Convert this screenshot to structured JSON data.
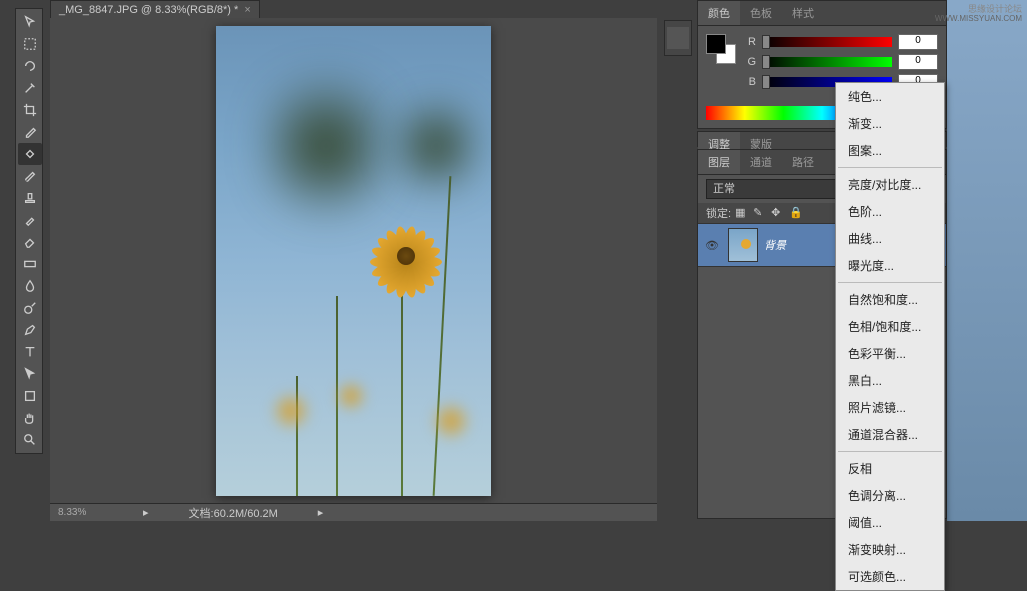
{
  "document": {
    "tab_title": "_MG_8847.JPG @ 8.33%(RGB/8*) *"
  },
  "status": {
    "zoom": "8.33%",
    "doc_label": "文档:60.2M/60.2M"
  },
  "color_panel": {
    "tabs": [
      "颜色",
      "色板",
      "样式"
    ],
    "channels": {
      "r": {
        "label": "R",
        "value": "0"
      },
      "g": {
        "label": "G",
        "value": "0"
      },
      "b": {
        "label": "B",
        "value": "0"
      }
    }
  },
  "adjust_panel": {
    "tabs": [
      "调整",
      "蒙版"
    ]
  },
  "layers_panel": {
    "tabs": [
      "图层",
      "通道",
      "路径"
    ],
    "blend_mode": "正常",
    "lock_label": "锁定:",
    "layer_name": "背景"
  },
  "context_menu": {
    "items": [
      {
        "label": "纯色..."
      },
      {
        "label": "渐变..."
      },
      {
        "label": "图案..."
      },
      {
        "sep": true
      },
      {
        "label": "亮度/对比度..."
      },
      {
        "label": "色阶..."
      },
      {
        "label": "曲线..."
      },
      {
        "label": "曝光度..."
      },
      {
        "sep": true
      },
      {
        "label": "自然饱和度..."
      },
      {
        "label": "色相/饱和度..."
      },
      {
        "label": "色彩平衡..."
      },
      {
        "label": "黑白..."
      },
      {
        "label": "照片滤镜..."
      },
      {
        "label": "通道混合器..."
      },
      {
        "sep": true
      },
      {
        "label": "反相"
      },
      {
        "label": "色调分离..."
      },
      {
        "label": "阈值..."
      },
      {
        "label": "渐变映射..."
      },
      {
        "label": "可选颜色..."
      }
    ]
  },
  "watermark": {
    "line1": "思缘设计论坛",
    "line2": "WWW.MISSYUAN.COM"
  }
}
